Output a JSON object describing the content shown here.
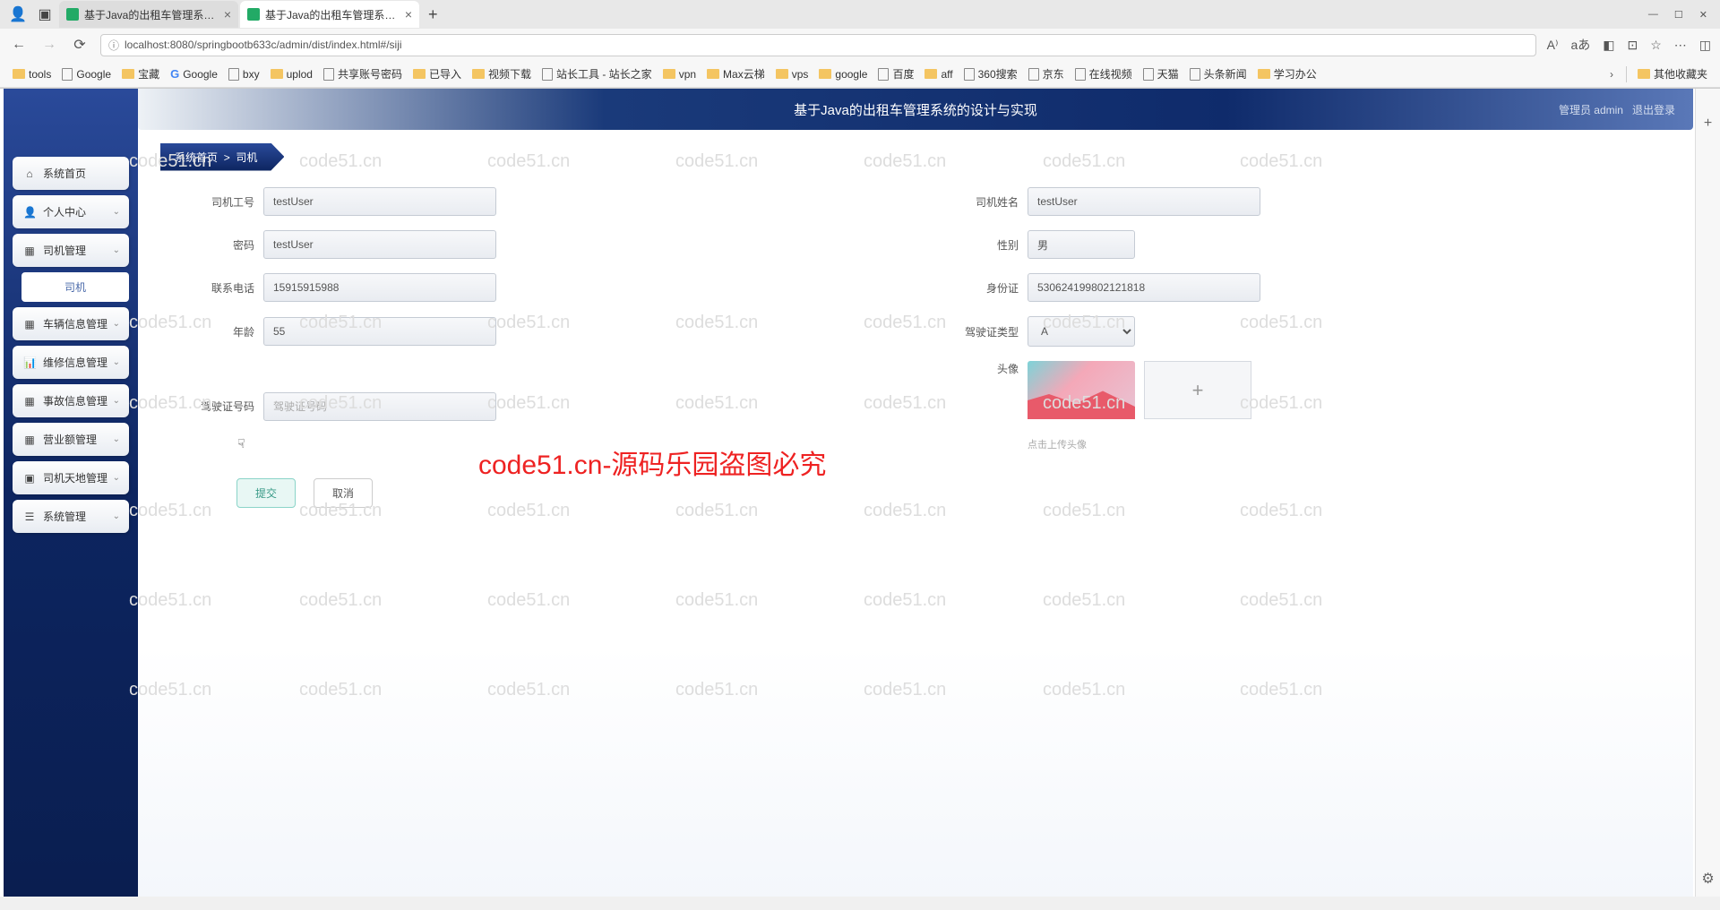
{
  "window": {
    "min": "—",
    "max": "☐",
    "close": "✕"
  },
  "tabs": [
    {
      "title": "基于Java的出租车管理系统的设计"
    },
    {
      "title": "基于Java的出租车管理系统的设计"
    }
  ],
  "url": "localhost:8080/springbootb633c/admin/dist/index.html#/siji",
  "bookmarks": {
    "items": [
      {
        "type": "folder",
        "label": "tools"
      },
      {
        "type": "page",
        "label": "Google"
      },
      {
        "type": "folder",
        "label": "宝藏"
      },
      {
        "type": "g",
        "label": "Google"
      },
      {
        "type": "icon",
        "label": "bxy"
      },
      {
        "type": "folder",
        "label": "uplod"
      },
      {
        "type": "icon",
        "label": "共享账号密码"
      },
      {
        "type": "folder",
        "label": "已导入"
      },
      {
        "type": "folder",
        "label": "视频下载"
      },
      {
        "type": "icon",
        "label": "站长工具 - 站长之家"
      },
      {
        "type": "folder",
        "label": "vpn"
      },
      {
        "type": "folder",
        "label": "Max云梯"
      },
      {
        "type": "folder",
        "label": "vps"
      },
      {
        "type": "folder",
        "label": "google"
      },
      {
        "type": "icon",
        "label": "百度"
      },
      {
        "type": "folder",
        "label": "aff"
      },
      {
        "type": "page",
        "label": "360搜索"
      },
      {
        "type": "page",
        "label": "京东"
      },
      {
        "type": "page",
        "label": "在线视频"
      },
      {
        "type": "page",
        "label": "天猫"
      },
      {
        "type": "page",
        "label": "头条新闻"
      },
      {
        "type": "folder",
        "label": "学习办公"
      }
    ],
    "other": "其他收藏夹"
  },
  "header": {
    "title": "基于Java的出租车管理系统的设计与实现",
    "role": "管理员 admin",
    "logout": "退出登录"
  },
  "sidebar": {
    "items": [
      {
        "icon": "⌂",
        "label": "系统首页",
        "expandable": false
      },
      {
        "icon": "👤",
        "label": "个人中心",
        "expandable": true
      },
      {
        "icon": "▦",
        "label": "司机管理",
        "expandable": true
      },
      {
        "icon": "",
        "label": "司机",
        "sub": true
      },
      {
        "icon": "▦",
        "label": "车辆信息管理",
        "expandable": true
      },
      {
        "icon": "📊",
        "label": "维修信息管理",
        "expandable": true
      },
      {
        "icon": "▦",
        "label": "事故信息管理",
        "expandable": true
      },
      {
        "icon": "▦",
        "label": "营业额管理",
        "expandable": true
      },
      {
        "icon": "▣",
        "label": "司机天地管理",
        "expandable": true
      },
      {
        "icon": "☰",
        "label": "系统管理",
        "expandable": true
      }
    ]
  },
  "breadcrumb": {
    "home": "系统首页",
    "sep": ">",
    "current": "司机"
  },
  "form": {
    "fields": {
      "driverId": {
        "label": "司机工号",
        "value": "testUser"
      },
      "driverName": {
        "label": "司机姓名",
        "value": "testUser"
      },
      "password": {
        "label": "密码",
        "value": "testUser"
      },
      "gender": {
        "label": "性别",
        "value": "男"
      },
      "phone": {
        "label": "联系电话",
        "value": "15915915988"
      },
      "idcard": {
        "label": "身份证",
        "value": "530624199802121818"
      },
      "age": {
        "label": "年龄",
        "value": "55"
      },
      "licenseType": {
        "label": "驾驶证类型",
        "value": "A"
      },
      "licenseNo": {
        "label": "驾驶证号码",
        "placeholder": "驾驶证号码",
        "value": ""
      },
      "avatar": {
        "label": "头像"
      }
    },
    "uploadHint": "点击上传头像",
    "submit": "提交",
    "cancel": "取消"
  },
  "watermark": "code51.cn",
  "bigWatermark": "code51.cn-源码乐园盗图必究"
}
